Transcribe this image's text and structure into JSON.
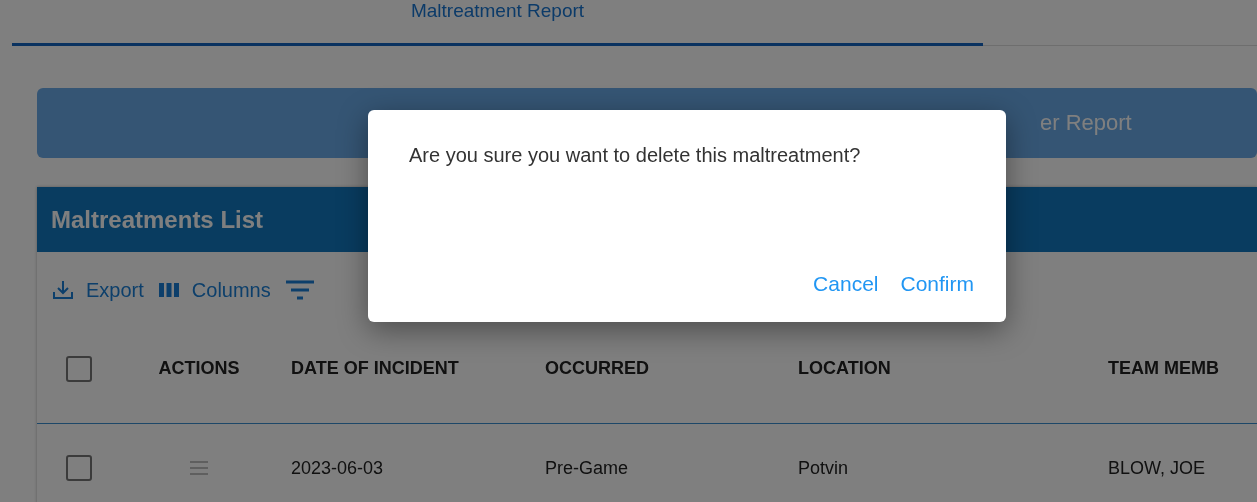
{
  "tabs": [
    {
      "label": "Maltreatment Report",
      "selected": true
    },
    {
      "selected": false
    }
  ],
  "report_button": {
    "label": "er Report"
  },
  "card": {
    "title": "Maltreatments List",
    "toolbar": [
      {
        "kind": "export",
        "label": "Export"
      },
      {
        "kind": "columns",
        "label": "Columns"
      },
      {
        "kind": "filter"
      }
    ],
    "actions_column": "ACTIONS",
    "columns": [
      "DATE OF INCIDENT",
      "OCCURRED",
      "LOCATION",
      "TEAM MEMB"
    ],
    "header_checked": false,
    "rows": [
      {
        "checked": false,
        "cells": [
          "2023-06-03",
          "Pre-Game",
          "Potvin",
          "BLOW, JOE"
        ]
      }
    ]
  },
  "dialog": {
    "message": "Are you sure you want to delete this maltreatment?",
    "buttons": [
      "Cancel",
      "Confirm"
    ]
  }
}
